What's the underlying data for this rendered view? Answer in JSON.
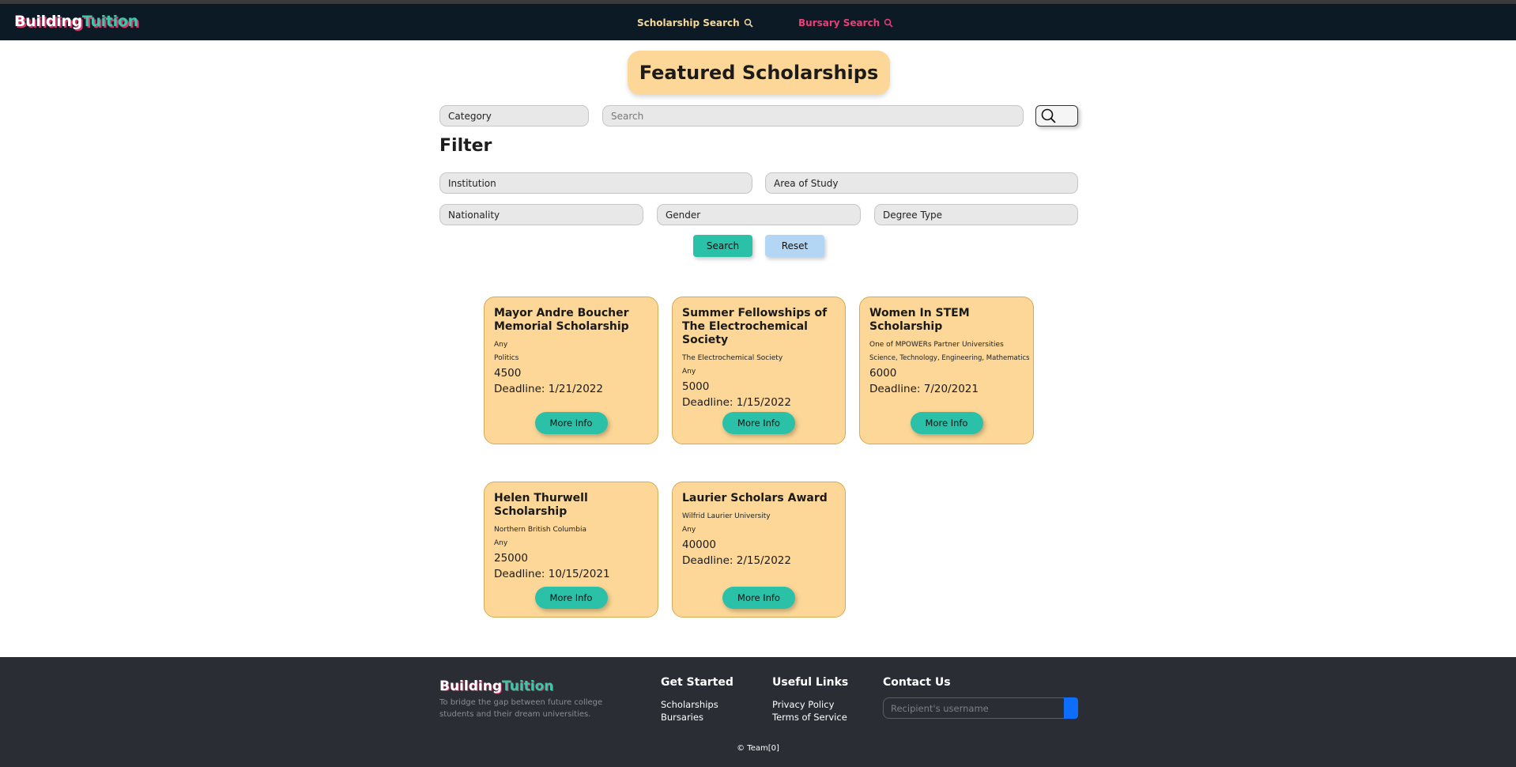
{
  "header": {
    "logo_part1": "Building",
    "logo_part2": "Tuition",
    "nav_scholarship": "Scholarship Search",
    "nav_bursary": "Bursary Search"
  },
  "hero": {
    "title": "Featured Scholarships"
  },
  "search": {
    "category": "Category",
    "placeholder": "Search"
  },
  "filter": {
    "title": "Filter",
    "institution": "Institution",
    "area_of_study": "Area of Study",
    "nationality": "Nationality",
    "gender": "Gender",
    "degree_type": "Degree Type",
    "search_label": "Search",
    "reset_label": "Reset"
  },
  "cards": [
    {
      "title": "Mayor Andre Boucher Memorial Scholarship",
      "line1": "Any",
      "line2": "Politics",
      "amount": "4500",
      "deadline": "Deadline: 1/21/2022",
      "button": "More Info"
    },
    {
      "title": "Summer Fellowships of The Electrochemical Society",
      "line1": "The Electrochemical Society",
      "line2": "Any",
      "amount": "5000",
      "deadline": "Deadline: 1/15/2022",
      "button": "More Info"
    },
    {
      "title": "Women In STEM Scholarship",
      "line1": "One of MPOWERs Partner Universities",
      "line2": "Science, Technology, Engineering, Mathematics",
      "amount": "6000",
      "deadline": "Deadline: 7/20/2021",
      "button": "More Info"
    },
    {
      "title": "Helen Thurwell Scholarship",
      "line1": "Northern British Columbia",
      "line2": "Any",
      "amount": "25000",
      "deadline": "Deadline: 10/15/2021",
      "button": "More Info"
    },
    {
      "title": "Laurier Scholars Award",
      "line1": "Wilfrid Laurier University",
      "line2": "Any",
      "amount": "40000",
      "deadline": "Deadline: 2/15/2022",
      "button": "More Info"
    }
  ],
  "footer": {
    "logo_part1": "Building",
    "logo_part2": "Tuition",
    "tagline": "To bridge the gap between future college students and their dream universities.",
    "get_started": "Get Started",
    "link_scholarships": "Scholarships",
    "link_bursaries": "Bursaries",
    "useful_links": "Useful Links",
    "link_privacy": "Privacy Policy",
    "link_terms": "Terms of Service",
    "contact_us": "Contact Us",
    "recipient_placeholder": "Recipient's username",
    "copyright": "© Team[0]"
  },
  "colors": {
    "header_bg": "#0c1a26",
    "card_bg": "#fcd797",
    "accent_teal": "#2bc0a8",
    "accent_pink": "#ec3f76",
    "reset_blue": "#b3d6f5",
    "footer_bg": "#2a2d33",
    "submit_blue": "#0d6efd"
  },
  "icons": {
    "nav_scholarship": "search-icon",
    "nav_bursary": "search-icon",
    "search_button": "search-icon"
  }
}
